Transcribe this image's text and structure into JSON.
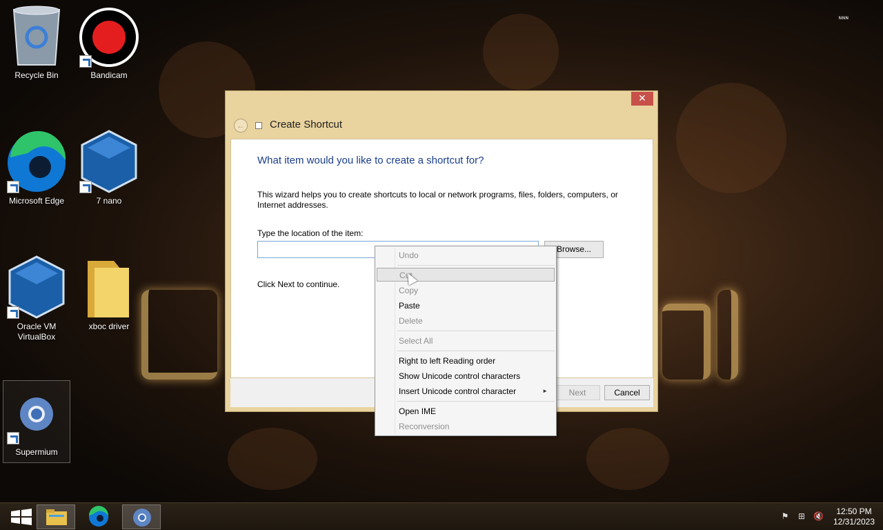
{
  "desktop": {
    "corner_logo": "ᴺᴺᴺ",
    "icons": [
      {
        "label": "Recycle Bin"
      },
      {
        "label": "Bandicam"
      },
      {
        "label": "Microsoft Edge"
      },
      {
        "label": "7 nano"
      },
      {
        "label": "Oracle VM VirtualBox"
      },
      {
        "label": "xboc driver"
      },
      {
        "label": "Supermium"
      }
    ]
  },
  "dialog": {
    "title": "Create Shortcut",
    "close_label": "✕",
    "back_label": "←",
    "heading": "What item would you like to create a shortcut for?",
    "description": "This wizard helps you to create shortcuts to local or network programs, files, folders, computers, or Internet addresses.",
    "location_label": "Type the location of the item:",
    "location_value": "",
    "browse_label": "Browse...",
    "continue_text": "Click Next to continue.",
    "next_label": "Next",
    "cancel_label": "Cancel"
  },
  "context_menu": {
    "items": [
      {
        "label": "Undo",
        "enabled": false
      },
      {
        "label": "Cut",
        "enabled": false,
        "highlighted": true
      },
      {
        "label": "Copy",
        "enabled": false
      },
      {
        "label": "Paste",
        "enabled": true
      },
      {
        "label": "Delete",
        "enabled": false
      },
      {
        "label": "Select All",
        "enabled": false
      },
      {
        "label": "Right to left Reading order",
        "enabled": true
      },
      {
        "label": "Show Unicode control characters",
        "enabled": true
      },
      {
        "label": "Insert Unicode control character",
        "enabled": true,
        "submenu": true
      },
      {
        "label": "Open IME",
        "enabled": true
      },
      {
        "label": "Reconversion",
        "enabled": false
      }
    ],
    "submenu_arrow": "►"
  },
  "taskbar": {
    "time": "12:50 PM",
    "date": "12/31/2023",
    "tray_icons": [
      "flag-icon",
      "network-icon",
      "volume-muted-icon"
    ]
  },
  "colors": {
    "dialog_frame": "#e9d39e",
    "heading_blue": "#1a3e8c",
    "close_red": "#c7504a"
  }
}
